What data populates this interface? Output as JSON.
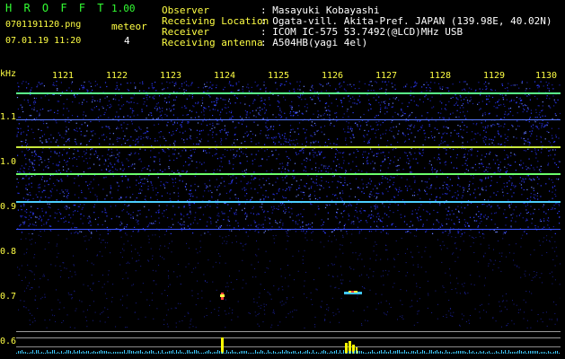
{
  "app": {
    "name": "H R O F F T",
    "version": "1.00"
  },
  "file": {
    "name": "0701191120.png",
    "datetime": "07.01.19 11:20"
  },
  "meteor": {
    "label": "meteor",
    "count": "4"
  },
  "info": [
    {
      "key": "Observer",
      "value": ": Masayuki Kobayashi"
    },
    {
      "key": "Receiving Location",
      "value": ": Ogata-vill. Akita-Pref. JAPAN (139.98E, 40.02N)"
    },
    {
      "key": "Receiver",
      "value": ": ICOM IC-575 53.7492(@LCD)MHz USB"
    },
    {
      "key": "Receiving antenna",
      "value": ": A504HB(yagi 4el)"
    }
  ],
  "axes": {
    "y_unit": "kHz",
    "y_ticks": [
      "1.1",
      "1.0",
      "0.9",
      "0.8",
      "0.7",
      "0.6"
    ],
    "x_ticks": [
      "1121",
      "1122",
      "1123",
      "1124",
      "1125",
      "1126",
      "1127",
      "1128",
      "1129",
      "1130"
    ]
  },
  "colors": {
    "label_green": "#33ff33",
    "label_yellow": "#ffff44",
    "noise_blue": "#2e3cff",
    "carrier_green": "#6cff6c",
    "histogram": "#ffff00",
    "baseline": "#40c8ff"
  }
}
